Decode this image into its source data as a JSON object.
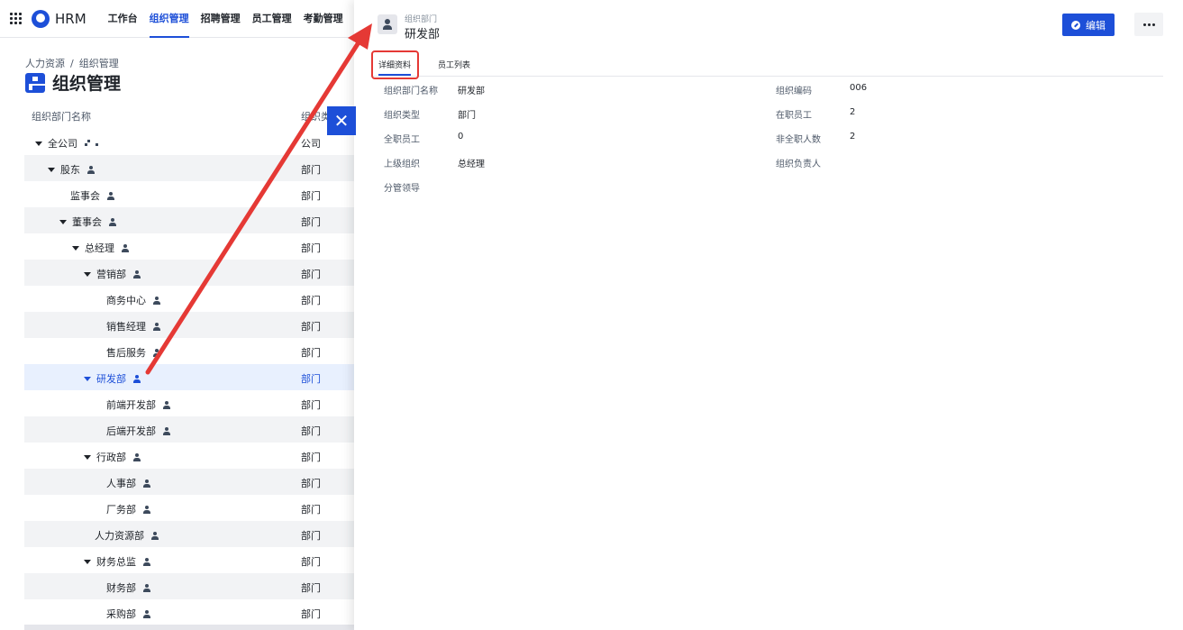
{
  "topnav": {
    "brand": "HRM",
    "items": [
      {
        "label": "工作台",
        "active": false
      },
      {
        "label": "组织管理",
        "active": true
      },
      {
        "label": "招聘管理",
        "active": false
      },
      {
        "label": "员工管理",
        "active": false
      },
      {
        "label": "考勤管理",
        "active": false
      }
    ]
  },
  "breadcrumb": {
    "root": "人力资源",
    "sep": "/",
    "current": "组织管理"
  },
  "page_title": "组织管理",
  "table": {
    "col_name": "组织部门名称",
    "col_type": "组织类",
    "rows": [
      {
        "name": "全公司",
        "type": "公司"
      },
      {
        "name": "股东",
        "type": "部门"
      },
      {
        "name": "监事会",
        "type": "部门"
      },
      {
        "name": "董事会",
        "type": "部门"
      },
      {
        "name": "总经理",
        "type": "部门"
      },
      {
        "name": "营销部",
        "type": "部门"
      },
      {
        "name": "商务中心",
        "type": "部门"
      },
      {
        "name": "销售经理",
        "type": "部门"
      },
      {
        "name": "售后服务",
        "type": "部门"
      },
      {
        "name": "研发部",
        "type": "部门"
      },
      {
        "name": "前端开发部",
        "type": "部门"
      },
      {
        "name": "后端开发部",
        "type": "部门"
      },
      {
        "name": "行政部",
        "type": "部门"
      },
      {
        "name": "人事部",
        "type": "部门"
      },
      {
        "name": "厂务部",
        "type": "部门"
      },
      {
        "name": "人力资源部",
        "type": "部门"
      },
      {
        "name": "财务总监",
        "type": "部门"
      },
      {
        "name": "财务部",
        "type": "部门"
      },
      {
        "name": "采购部",
        "type": "部门"
      }
    ]
  },
  "close_icon": "✕",
  "drawer": {
    "subtitle": "组织部门",
    "title": "研发部",
    "edit_label": "编辑",
    "tabs": [
      "详细资料",
      "员工列表"
    ],
    "fields": [
      {
        "label": "组织部门名称",
        "value": "研发部"
      },
      {
        "label": "组织编码",
        "value": "006"
      },
      {
        "label": "组织类型",
        "value": "部门"
      },
      {
        "label": "在职员工",
        "value": "2"
      },
      {
        "label": "全职员工",
        "value": "0"
      },
      {
        "label": "非全职人数",
        "value": "2"
      },
      {
        "label": "上级组织",
        "value": "总经理"
      },
      {
        "label": "组织负责人",
        "value": ""
      },
      {
        "label": "分管领导",
        "value": ""
      }
    ]
  },
  "colors": {
    "accent": "#1d4fd8",
    "annotation": "#e53935",
    "selected_row": "#e8f0fe"
  }
}
